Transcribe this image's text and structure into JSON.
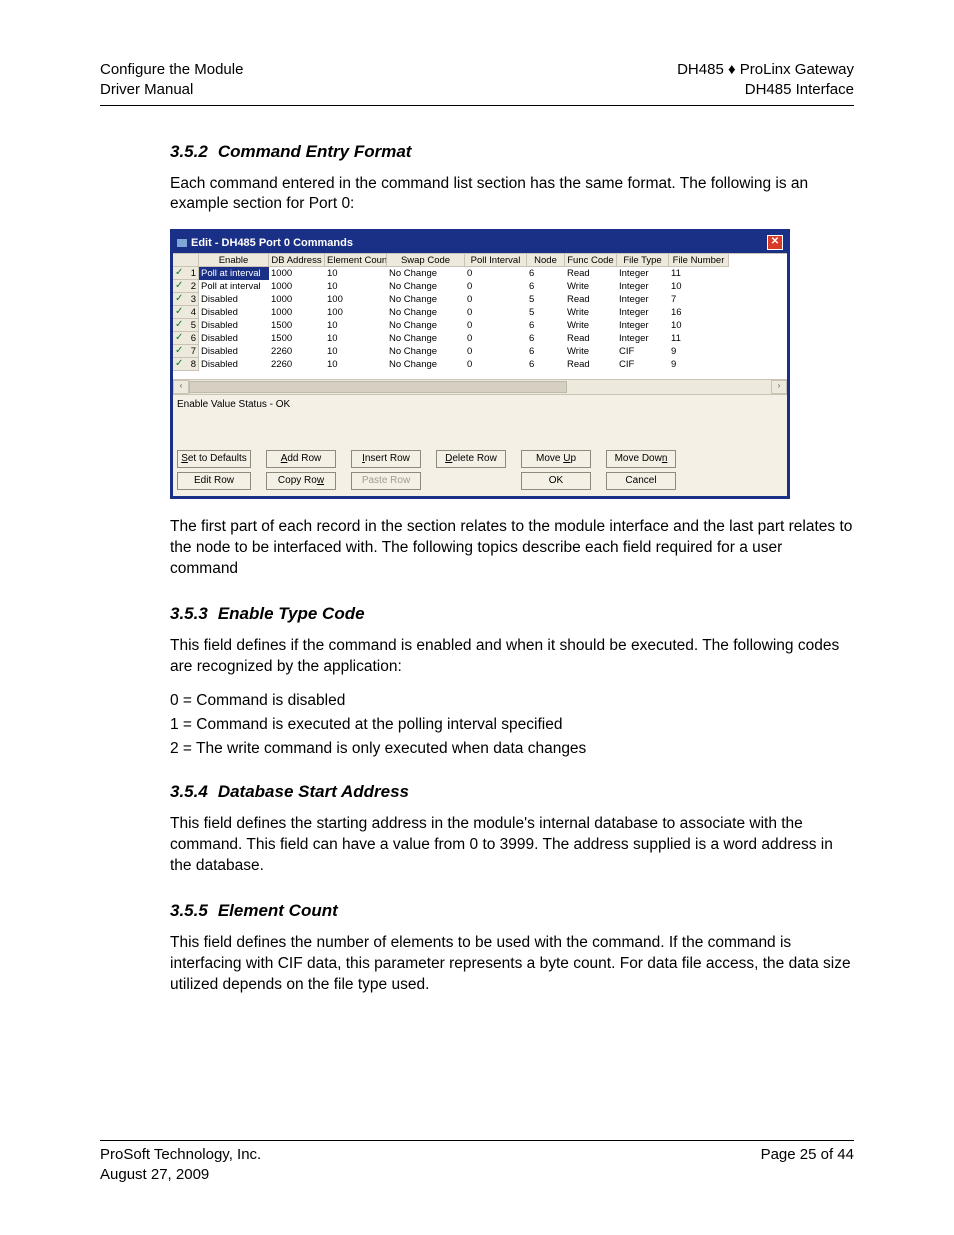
{
  "header": {
    "left1": "Configure the Module",
    "left2": "Driver Manual",
    "right1": "DH485 ♦ ProLinx Gateway",
    "right2": "DH485 Interface"
  },
  "sections": {
    "s352": {
      "num": "3.5.2",
      "title": "Command Entry Format",
      "p1": "Each command entered in the command list section has the same format. The following is an example section for Port 0:",
      "p2": "The first part of each record in the section relates to the module interface and the last part relates to the node to be interfaced with. The following topics describe each field required for a user command"
    },
    "s353": {
      "num": "3.5.3",
      "title": "Enable Type Code",
      "p1": "This field defines if the command is enabled and when it should be executed. The following codes are recognized by the application:",
      "l0": "0 = Command is disabled",
      "l1": "1 = Command is executed at the polling interval specified",
      "l2": "2 = The write command is only executed when data changes"
    },
    "s354": {
      "num": "3.5.4",
      "title": "Database Start Address",
      "p1": "This field defines the starting address in the module's internal database to associate with the command. This field can have a value from 0 to 3999. The address supplied is a word address in the database."
    },
    "s355": {
      "num": "3.5.5",
      "title": "Element Count",
      "p1": "This field defines the number of elements to be used with the command. If the command is interfacing with CIF data, this parameter represents a byte count. For data file access, the data size utilized depends on the file type used."
    }
  },
  "dialog": {
    "title": "Edit - DH485 Port 0 Commands",
    "columns": [
      "",
      "Enable",
      "DB Address",
      "Element Count",
      "Swap Code",
      "Poll Interval",
      "Node",
      "Func Code",
      "File Type",
      "File Number"
    ],
    "rows": [
      {
        "n": "1",
        "enable": "Poll at interval",
        "db": "1000",
        "el": "10",
        "swap": "No Change",
        "poll": "0",
        "node": "6",
        "func": "Read",
        "ftype": "Integer",
        "fnum": "11"
      },
      {
        "n": "2",
        "enable": "Poll at interval",
        "db": "1000",
        "el": "10",
        "swap": "No Change",
        "poll": "0",
        "node": "6",
        "func": "Write",
        "ftype": "Integer",
        "fnum": "10"
      },
      {
        "n": "3",
        "enable": "Disabled",
        "db": "1000",
        "el": "100",
        "swap": "No Change",
        "poll": "0",
        "node": "5",
        "func": "Read",
        "ftype": "Integer",
        "fnum": "7"
      },
      {
        "n": "4",
        "enable": "Disabled",
        "db": "1000",
        "el": "100",
        "swap": "No Change",
        "poll": "0",
        "node": "5",
        "func": "Write",
        "ftype": "Integer",
        "fnum": "16"
      },
      {
        "n": "5",
        "enable": "Disabled",
        "db": "1500",
        "el": "10",
        "swap": "No Change",
        "poll": "0",
        "node": "6",
        "func": "Write",
        "ftype": "Integer",
        "fnum": "10"
      },
      {
        "n": "6",
        "enable": "Disabled",
        "db": "1500",
        "el": "10",
        "swap": "No Change",
        "poll": "0",
        "node": "6",
        "func": "Read",
        "ftype": "Integer",
        "fnum": "11"
      },
      {
        "n": "7",
        "enable": "Disabled",
        "db": "2260",
        "el": "10",
        "swap": "No Change",
        "poll": "0",
        "node": "6",
        "func": "Write",
        "ftype": "CIF",
        "fnum": "9"
      },
      {
        "n": "8",
        "enable": "Disabled",
        "db": "2260",
        "el": "10",
        "swap": "No Change",
        "poll": "0",
        "node": "6",
        "func": "Read",
        "ftype": "CIF",
        "fnum": "9"
      }
    ],
    "status": "Enable Value Status - OK",
    "buttons": {
      "set_defaults": "Set to Defaults",
      "add_row": "Add Row",
      "insert_row": "Insert Row",
      "delete_row": "Delete Row",
      "move_up": "Move Up",
      "move_down": "Move Down",
      "edit_row": "Edit Row",
      "copy_row": "Copy Row",
      "paste_row": "Paste Row",
      "ok": "OK",
      "cancel": "Cancel"
    }
  },
  "footer": {
    "left1": "ProSoft Technology, Inc.",
    "left2": "August 27, 2009",
    "right1": "Page 25 of 44"
  }
}
